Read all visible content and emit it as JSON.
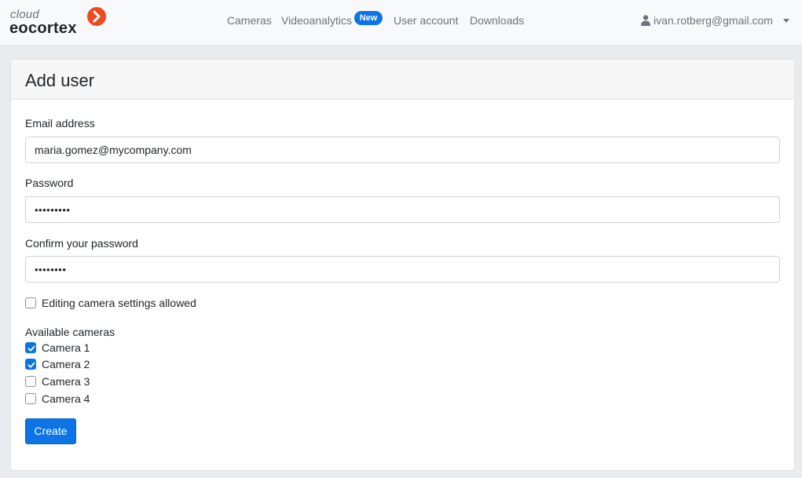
{
  "brand": {
    "cloud_text": "cloud",
    "name_text": "eocortex",
    "mark_icon": "chevron-right-icon",
    "mark_color": "#ee4a22"
  },
  "nav": {
    "items": [
      {
        "label": "Cameras"
      },
      {
        "label": "Videoanalytics",
        "badge": "New"
      },
      {
        "label": "User account"
      },
      {
        "label": "Downloads"
      }
    ],
    "badge_color": "#0d74e6"
  },
  "user_menu": {
    "icon": "user-icon",
    "email": "ivan.rotberg@gmail.com",
    "caret_icon": "caret-down-icon"
  },
  "form": {
    "title": "Add user",
    "email": {
      "label": "Email address",
      "value": "maria.gomez@mycompany.com"
    },
    "password": {
      "label": "Password",
      "masked": "•••••••••"
    },
    "confirm": {
      "label": "Confirm your password",
      "masked": "••••••••"
    },
    "editing_allowed": {
      "label": "Editing camera settings allowed",
      "checked": false
    },
    "cameras_label": "Available cameras",
    "cameras": [
      {
        "label": "Camera 1",
        "checked": true
      },
      {
        "label": "Camera 2",
        "checked": true
      },
      {
        "label": "Camera 3",
        "checked": false
      },
      {
        "label": "Camera 4",
        "checked": false
      }
    ],
    "submit_label": "Create",
    "accent_color": "#0d74e6"
  }
}
